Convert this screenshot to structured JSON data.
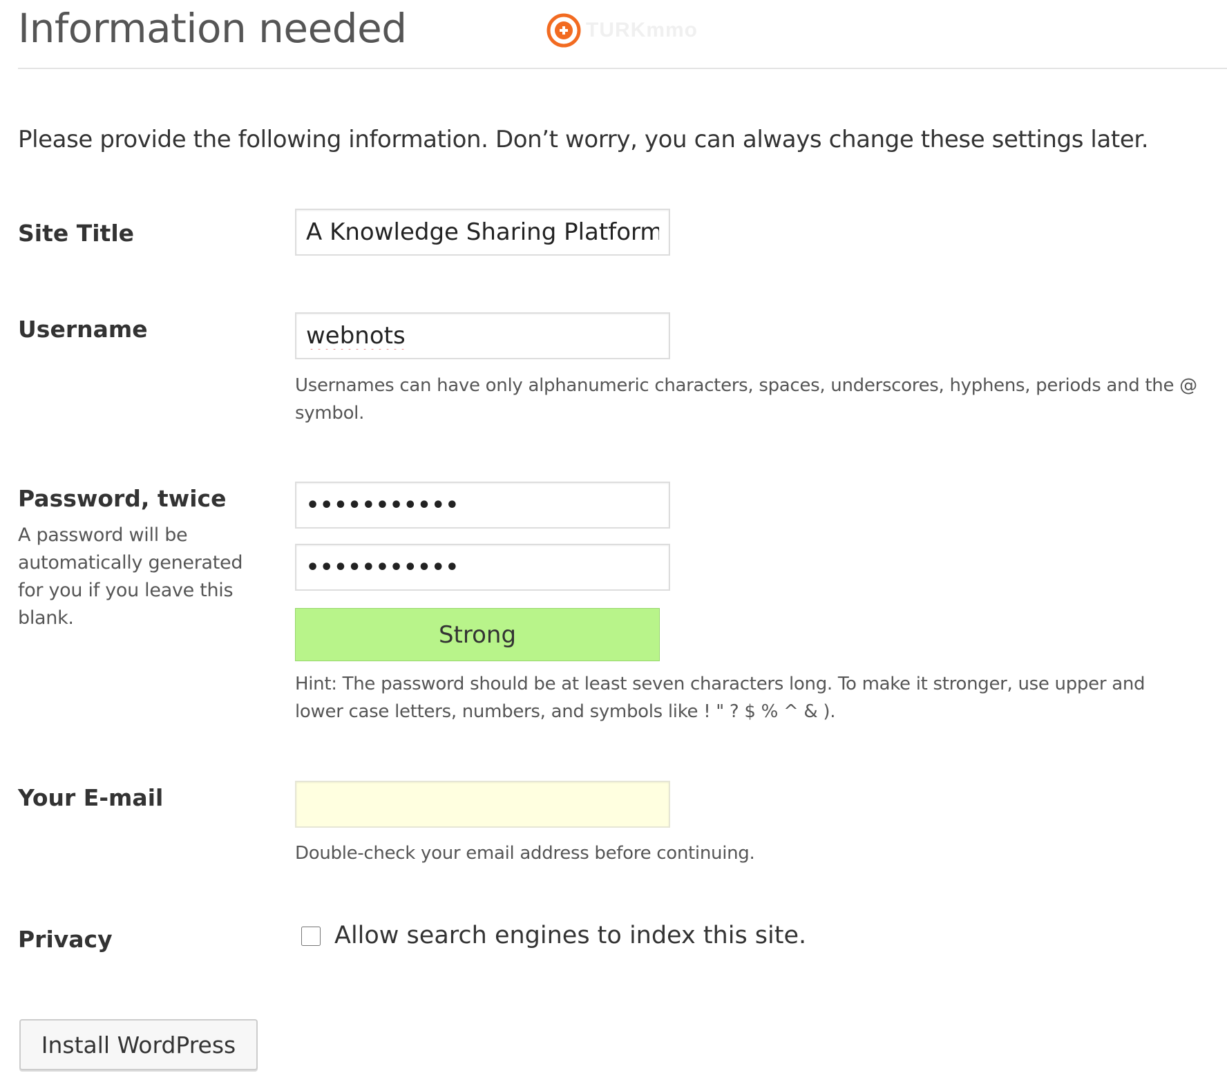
{
  "page": {
    "title": "Information needed",
    "intro": "Please provide the following information. Don’t worry, you can always change these settings later."
  },
  "watermark": {
    "text": "TURKmmo",
    "color": "#f26b21"
  },
  "form": {
    "site_title": {
      "label": "Site Title",
      "value": "A Knowledge Sharing Platform"
    },
    "username": {
      "label": "Username",
      "value": "webnots",
      "help": "Usernames can have only alphanumeric characters, spaces, underscores, hyphens, periods and the @ symbol."
    },
    "password": {
      "label": "Password, twice",
      "help": "A password will be automatically generated for you if you leave this blank.",
      "value1": "•••••••••••",
      "value2": "•••••••••••",
      "strength_label": "Strong",
      "strength_color": "#b8f48a",
      "hint": "Hint: The password should be at least seven characters long. To make it stronger, use upper and lower case letters, numbers, and symbols like ! \" ? $ % ^ & )."
    },
    "email": {
      "label": "Your E-mail",
      "value": "",
      "help": "Double-check your email address before continuing."
    },
    "privacy": {
      "label": "Privacy",
      "checkbox_label": "Allow search engines to index this site.",
      "checked": false
    },
    "submit_label": "Install WordPress"
  }
}
